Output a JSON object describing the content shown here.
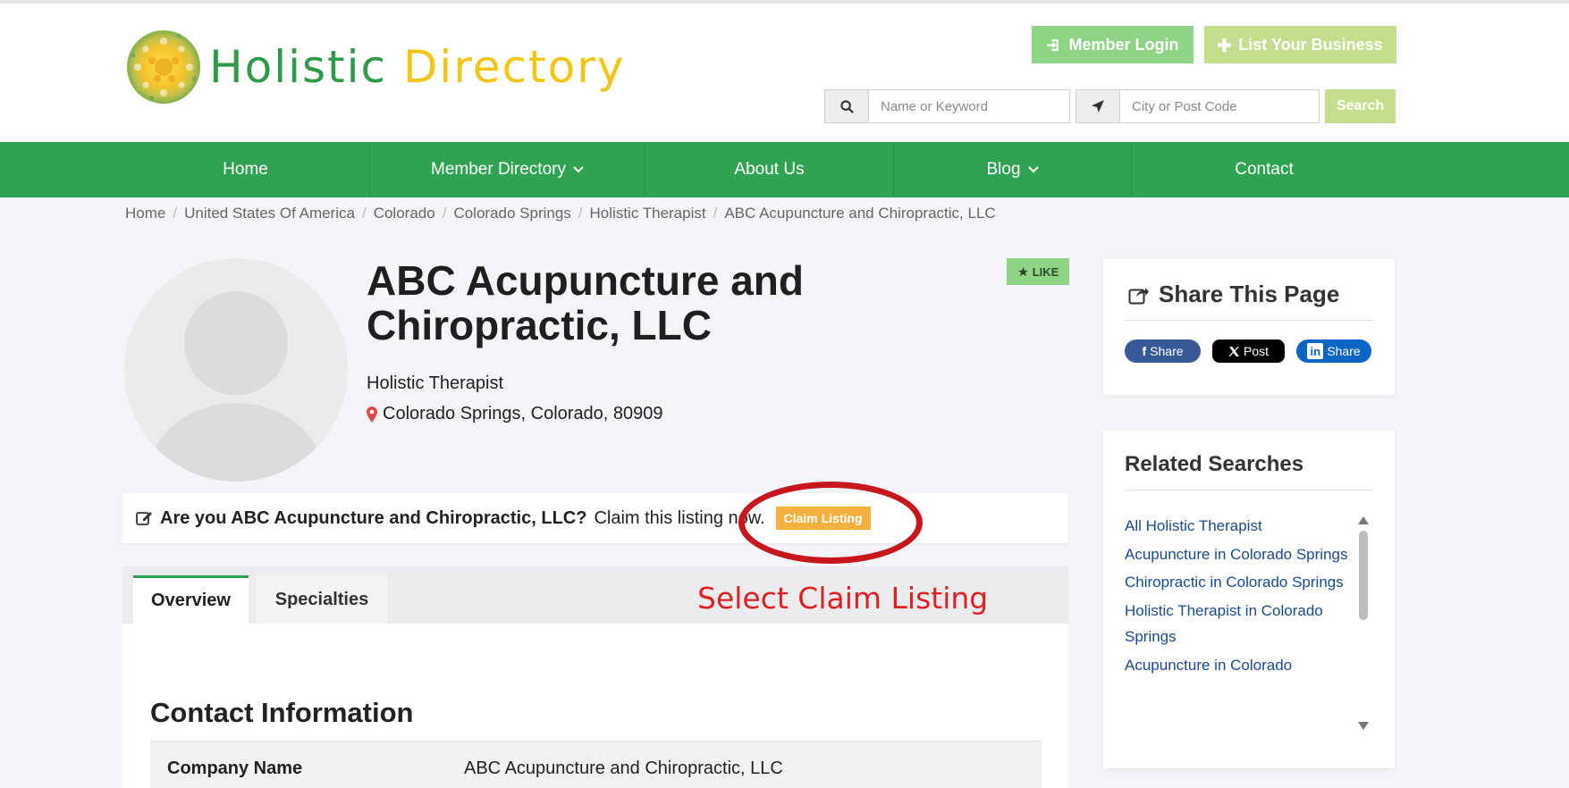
{
  "brand": {
    "word1": "Holistic",
    "word2": "Directory",
    "green": "#2f9a4a",
    "yellow": "#f2c516"
  },
  "header": {
    "member_login": "Member Login",
    "list_business": "List Your Business",
    "search": {
      "keyword_placeholder": "Name or Keyword",
      "location_placeholder": "City or Post Code",
      "button": "Search"
    }
  },
  "nav": {
    "color": "#2fa352",
    "items": [
      {
        "label": "Home",
        "has_dropdown": false
      },
      {
        "label": "Member Directory",
        "has_dropdown": true
      },
      {
        "label": "About Us",
        "has_dropdown": false
      },
      {
        "label": "Blog",
        "has_dropdown": true
      },
      {
        "label": "Contact",
        "has_dropdown": false
      }
    ]
  },
  "breadcrumb": [
    "Home",
    "United States Of America",
    "Colorado",
    "Colorado Springs",
    "Holistic Therapist",
    "ABC Acupuncture and Chiropractic, LLC"
  ],
  "listing": {
    "title": "ABC Acupuncture and Chiropractic, LLC",
    "like": "LIKE",
    "category": "Holistic Therapist",
    "location": "Colorado Springs, Colorado, 80909"
  },
  "claim": {
    "question": "Are you ABC Acupuncture and Chiropractic, LLC?",
    "text": "Claim this listing now.",
    "button": "Claim Listing",
    "annotation": "Select Claim Listing"
  },
  "tabs": [
    {
      "label": "Overview",
      "active": true
    },
    {
      "label": "Specialties",
      "active": false
    }
  ],
  "contact": {
    "title": "Contact Information",
    "rows": [
      {
        "label": "Company Name",
        "value": "ABC Acupuncture and Chiropractic, LLC"
      }
    ]
  },
  "share": {
    "title": "Share This Page",
    "facebook": "Share",
    "x": "Post",
    "linkedin": "Share"
  },
  "related": {
    "title": "Related Searches",
    "links": [
      "All Holistic Therapist",
      "Acupuncture in Colorado Springs",
      "Chiropractic in Colorado Springs",
      "Holistic Therapist in Colorado Springs",
      "Acupuncture in Colorado"
    ]
  }
}
